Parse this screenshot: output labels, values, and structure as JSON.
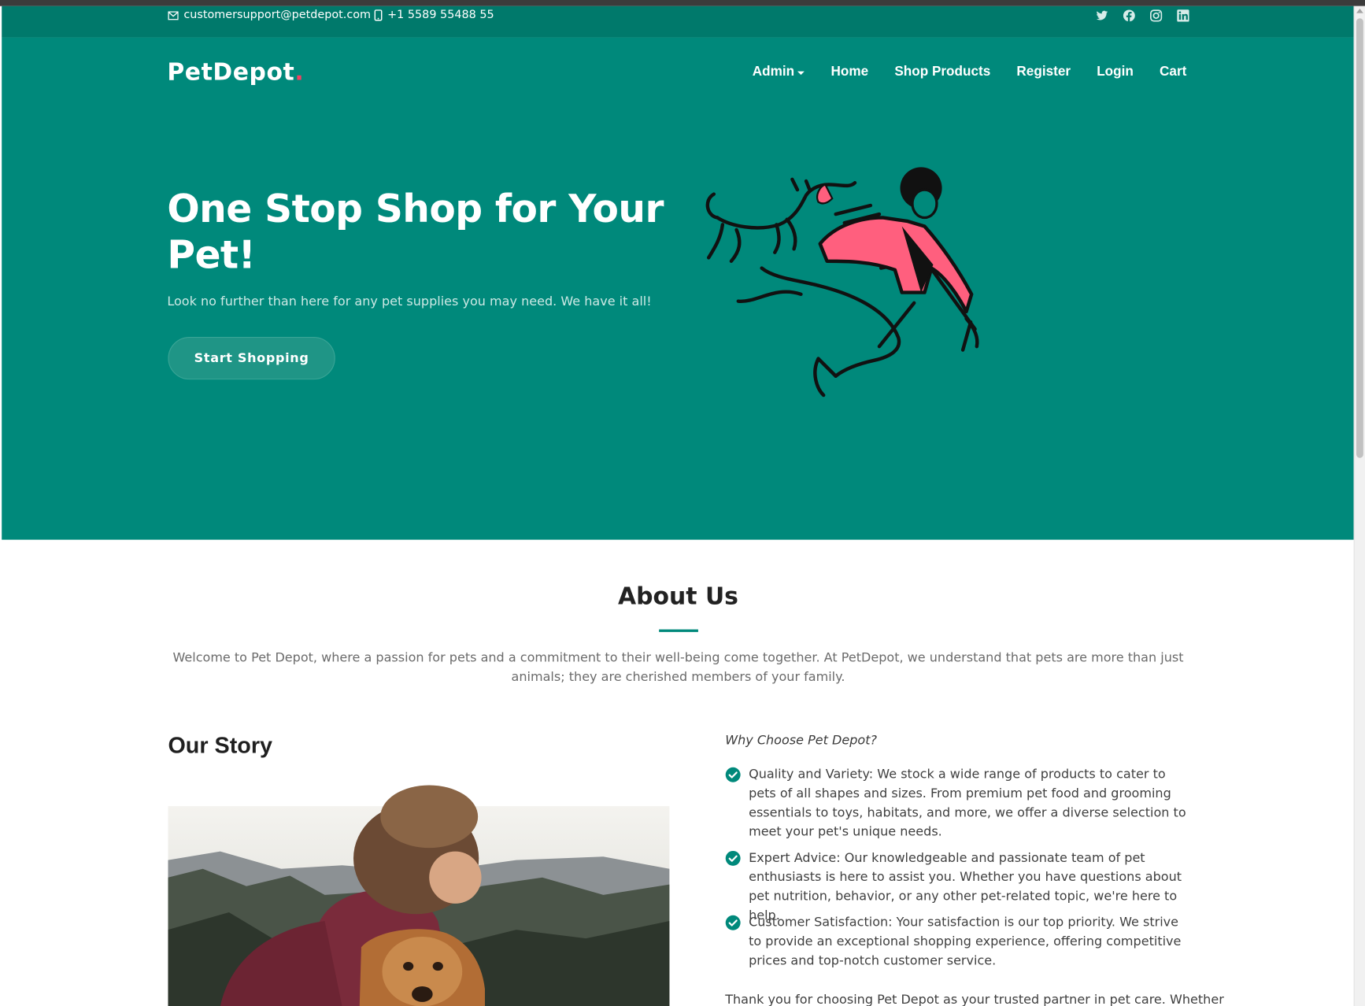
{
  "topbar": {
    "email": "customersupport@petdepot.com",
    "phone": "+1 5589 55488 55",
    "social_icons": [
      "twitter-icon",
      "facebook-icon",
      "instagram-icon",
      "linkedin-icon"
    ]
  },
  "header": {
    "logo_text": "PetDepot",
    "logo_dot": ".",
    "nav": {
      "admin": "Admin",
      "home": "Home",
      "shop": "Shop Products",
      "register": "Register",
      "login": "Login",
      "cart": "Cart"
    }
  },
  "hero": {
    "title": "One Stop Shop for Your Pet!",
    "subtitle": "Look no further than here for any pet supplies you may need. We have it all!",
    "button": "Start Shopping"
  },
  "about": {
    "title": "About Us",
    "text": "Welcome to Pet Depot, where a passion for pets and a commitment to their well-being come together. At PetDepot, we understand that pets are more than just animals; they are cherished members of your family."
  },
  "story": {
    "title": "Our Story"
  },
  "why": {
    "title": "Why Choose Pet Depot?",
    "items": [
      "Quality and Variety: We stock a wide range of products to cater to pets of all shapes and sizes. From premium pet food and grooming essentials to toys, habitats, and more, we offer a diverse selection to meet your pet's unique needs.",
      "Expert Advice: Our knowledgeable and passionate team of pet enthusiasts is here to assist you. Whether you have questions about pet nutrition, behavior, or any other pet-related topic, we're here to help.",
      "Customer Satisfaction: Your satisfaction is our top priority. We strive to provide an exceptional shopping experience, offering competitive prices and top-notch customer service."
    ],
    "closing": "Thank you for choosing Pet Depot as your trusted partner in pet care. Whether"
  },
  "colors": {
    "topbar": "#00796b",
    "hero": "#00897b",
    "accent": "#f44061",
    "check": "#00897b"
  }
}
